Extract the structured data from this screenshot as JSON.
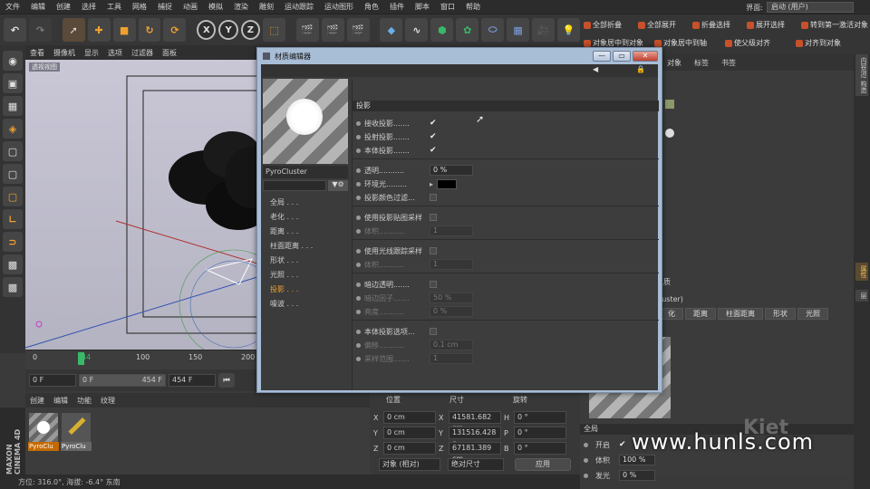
{
  "menubar": {
    "items": [
      "文件",
      "编辑",
      "创建",
      "选择",
      "工具",
      "网格",
      "捕捉",
      "动画",
      "模拟",
      "渲染",
      "雕刻",
      "运动跟踪",
      "运动图形",
      "角色",
      "插件",
      "脚本",
      "窗口",
      "帮助"
    ],
    "layout_label": "界面:",
    "layout_value": "启动 (用户)"
  },
  "toolbar": {
    "axis_x": "X",
    "axis_y": "Y",
    "axis_z": "Z"
  },
  "right_toolbar": {
    "row1": [
      "全部折叠",
      "全部展开",
      "折叠选择",
      "展开选择",
      "转到第一激活对象"
    ],
    "row2": [
      "对象居中到对象",
      "对象居中到轴",
      "使父级对齐",
      "对齐到对象"
    ]
  },
  "object_manager": {
    "menu": [
      "对象",
      "标签",
      "书签"
    ]
  },
  "viewport": {
    "menu": [
      "查看",
      "摄像机",
      "显示",
      "选项",
      "过滤器",
      "面板"
    ],
    "label": "透视视图"
  },
  "timeline": {
    "ticks": [
      "0",
      "44",
      "100",
      "150",
      "200"
    ],
    "current_frame": "0 F",
    "range_start": "0 F",
    "range_end": "454 F",
    "end_field": "454 F"
  },
  "materials": {
    "menu": [
      "创建",
      "编辑",
      "功能",
      "纹理"
    ],
    "items": [
      "PyroClu",
      "PyroClu"
    ]
  },
  "status": {
    "text": "方位: 316.0°, 海拔: -6.4° 东南"
  },
  "coords": {
    "headers": [
      "位置",
      "尺寸",
      "旋转"
    ],
    "rows": [
      {
        "a": "X",
        "av": "0 cm",
        "b": "X",
        "bv": "41581.682 cm",
        "c": "H",
        "cv": "0 °"
      },
      {
        "a": "Y",
        "av": "0 cm",
        "b": "Y",
        "bv": "131516.428 c",
        "c": "P",
        "cv": "0 °"
      },
      {
        "a": "Z",
        "av": "0 cm",
        "b": "Z",
        "bv": "67181.389 cm",
        "c": "B",
        "cv": "0 °"
      }
    ],
    "mode": "对象 (相对)",
    "size_mode": "绝对尺寸",
    "apply": "应用"
  },
  "attributes": {
    "partial_title": "质",
    "partial_name": "luster)",
    "tabs": [
      "化",
      "距离",
      "柱面距离",
      "形状",
      "光照"
    ],
    "section": "全局",
    "rows": [
      {
        "label": "开启",
        "value": "✔"
      },
      {
        "label": "体积",
        "value": "100 %"
      },
      {
        "label": "发光",
        "value": "0 %"
      }
    ]
  },
  "side_tabs": [
    "内容浏览器",
    "构造",
    "属性",
    "层"
  ],
  "dialog": {
    "title": "材质编辑器",
    "material_name": "PyroCluster",
    "channels": [
      "全局",
      "老化",
      "距离",
      "柱面距离",
      "形状",
      "光照",
      "投影",
      "噪波"
    ],
    "active_channel": 6,
    "panel_title": "投影",
    "groups": [
      {
        "label": "接收投影",
        "dots": ".......",
        "kind": "check",
        "value": "✔"
      },
      {
        "label": "投射投影",
        "dots": ".......",
        "kind": "check",
        "value": "✔"
      },
      {
        "label": "本体投影",
        "dots": ".......",
        "kind": "check",
        "value": "✔"
      },
      {
        "label": "透明",
        "dots": "...........",
        "kind": "field",
        "value": "0 %"
      },
      {
        "label": "环境光",
        "dots": ".........",
        "kind": "color",
        "value": "#000000"
      },
      {
        "label": "投影颜色过滤",
        "dots": "...",
        "kind": "box",
        "value": ""
      },
      {
        "label": "使用投影贴图采样",
        "dots": "",
        "kind": "box",
        "value": ""
      },
      {
        "label": "体积",
        "dots": "...........",
        "kind": "dimfield",
        "value": "1"
      },
      {
        "label": "使用光线跟踪采样",
        "dots": "",
        "kind": "box",
        "value": ""
      },
      {
        "label": "体积",
        "dots": "...........",
        "kind": "dimfield",
        "value": "1"
      },
      {
        "label": "暗边透明",
        "dots": ".......",
        "kind": "box",
        "value": ""
      },
      {
        "label": "暗边因子",
        "dots": ".......",
        "kind": "dimfield",
        "value": "50 %"
      },
      {
        "label": "亮度",
        "dots": "...........",
        "kind": "dimfield",
        "value": "0 %"
      },
      {
        "label": "本体投影选项",
        "dots": "...",
        "kind": "box",
        "value": ""
      },
      {
        "label": "偏移",
        "dots": "...........",
        "kind": "dimfield",
        "value": "0.1 cm"
      },
      {
        "label": "采样范围",
        "dots": ".......",
        "kind": "dimfield",
        "value": "1"
      }
    ]
  },
  "watermark": "www.hunls.com",
  "brand": "MAXON CINEMA 4D"
}
